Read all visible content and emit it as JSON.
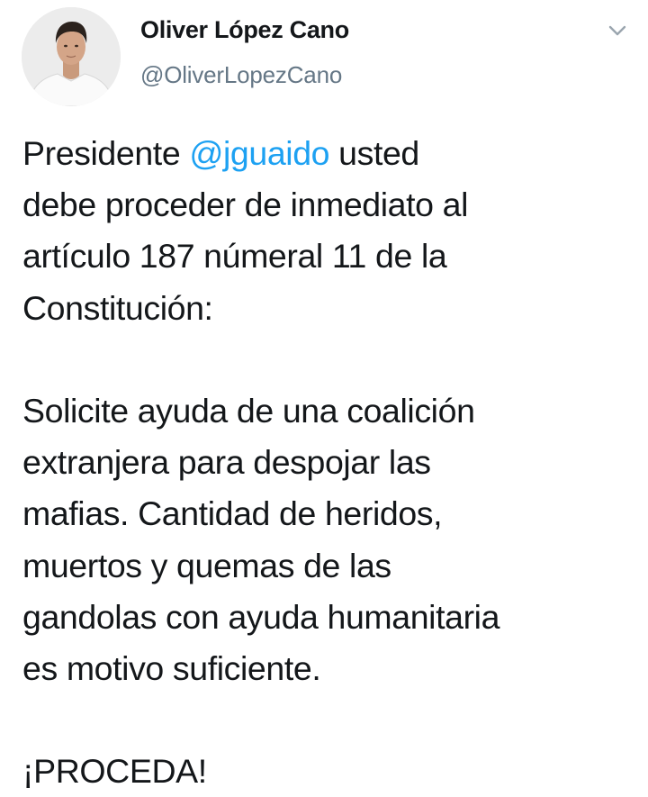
{
  "author": {
    "display_name": "Oliver López Cano",
    "handle": "@OliverLopezCano",
    "avatar_icon": "profile-photo"
  },
  "menu": {
    "icon": "chevron-down-icon"
  },
  "tweet": {
    "paragraph1": {
      "line1_before": "Presidente ",
      "line1_mention": "@jguaido",
      "line1_after": " usted",
      "line2": "debe proceder de inmediato al",
      "line3": "artículo 187 númeral 11 de la",
      "line4": "Constitución:"
    },
    "paragraph2": {
      "line1": "Solicite ayuda de una coalición",
      "line2": "extranjera para despojar las",
      "line3": "mafias. Cantidad de heridos,",
      "line4": "muertos y quemas de las",
      "line5": "gandolas con ayuda humanitaria",
      "line6": "es motivo suficiente."
    },
    "paragraph3": {
      "line1": "¡PROCEDA!"
    }
  },
  "colors": {
    "text": "#14171a",
    "secondary": "#657786",
    "link": "#1da1f2"
  }
}
